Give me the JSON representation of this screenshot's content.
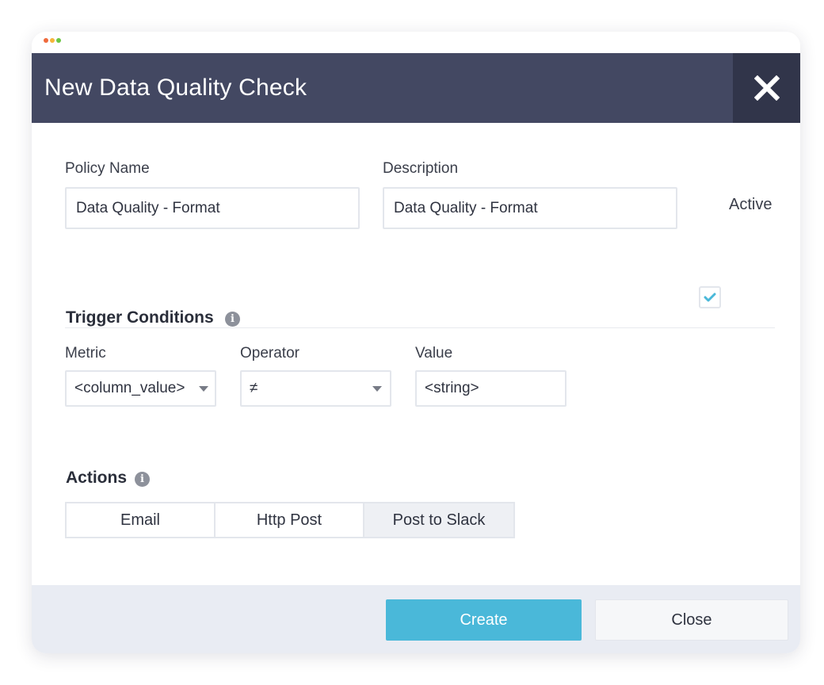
{
  "colors": {
    "header_bg": "#434862",
    "close_bg": "#31354a",
    "accent": "#4ab8d9",
    "info_icon": "#8d919b",
    "footer_bg": "#e9ecf3",
    "segment_active_bg": "#eef0f4",
    "dot_red": "#ef6a3c",
    "dot_yellow": "#f5b53a",
    "dot_green": "#6cc644"
  },
  "dialog": {
    "title": "New Data Quality Check",
    "close_icon": "close-icon"
  },
  "policy": {
    "name_label": "Policy Name",
    "name_value": "Data Quality - Format",
    "description_label": "Description",
    "description_value": "Data Quality - Format",
    "active_label": "Active",
    "active_checked": true
  },
  "trigger": {
    "title": "Trigger Conditions",
    "info_icon": "info-icon",
    "metric_label": "Metric",
    "metric_value": "<column_value>",
    "operator_label": "Operator",
    "operator_value": "≠",
    "value_label": "Value",
    "value_value": "<string>"
  },
  "actions": {
    "title": "Actions",
    "info_icon": "info-icon",
    "options": [
      {
        "label": "Email",
        "selected": false
      },
      {
        "label": "Http Post",
        "selected": false
      },
      {
        "label": "Post to Slack",
        "selected": true
      }
    ]
  },
  "footer": {
    "create_label": "Create",
    "close_label": "Close"
  }
}
